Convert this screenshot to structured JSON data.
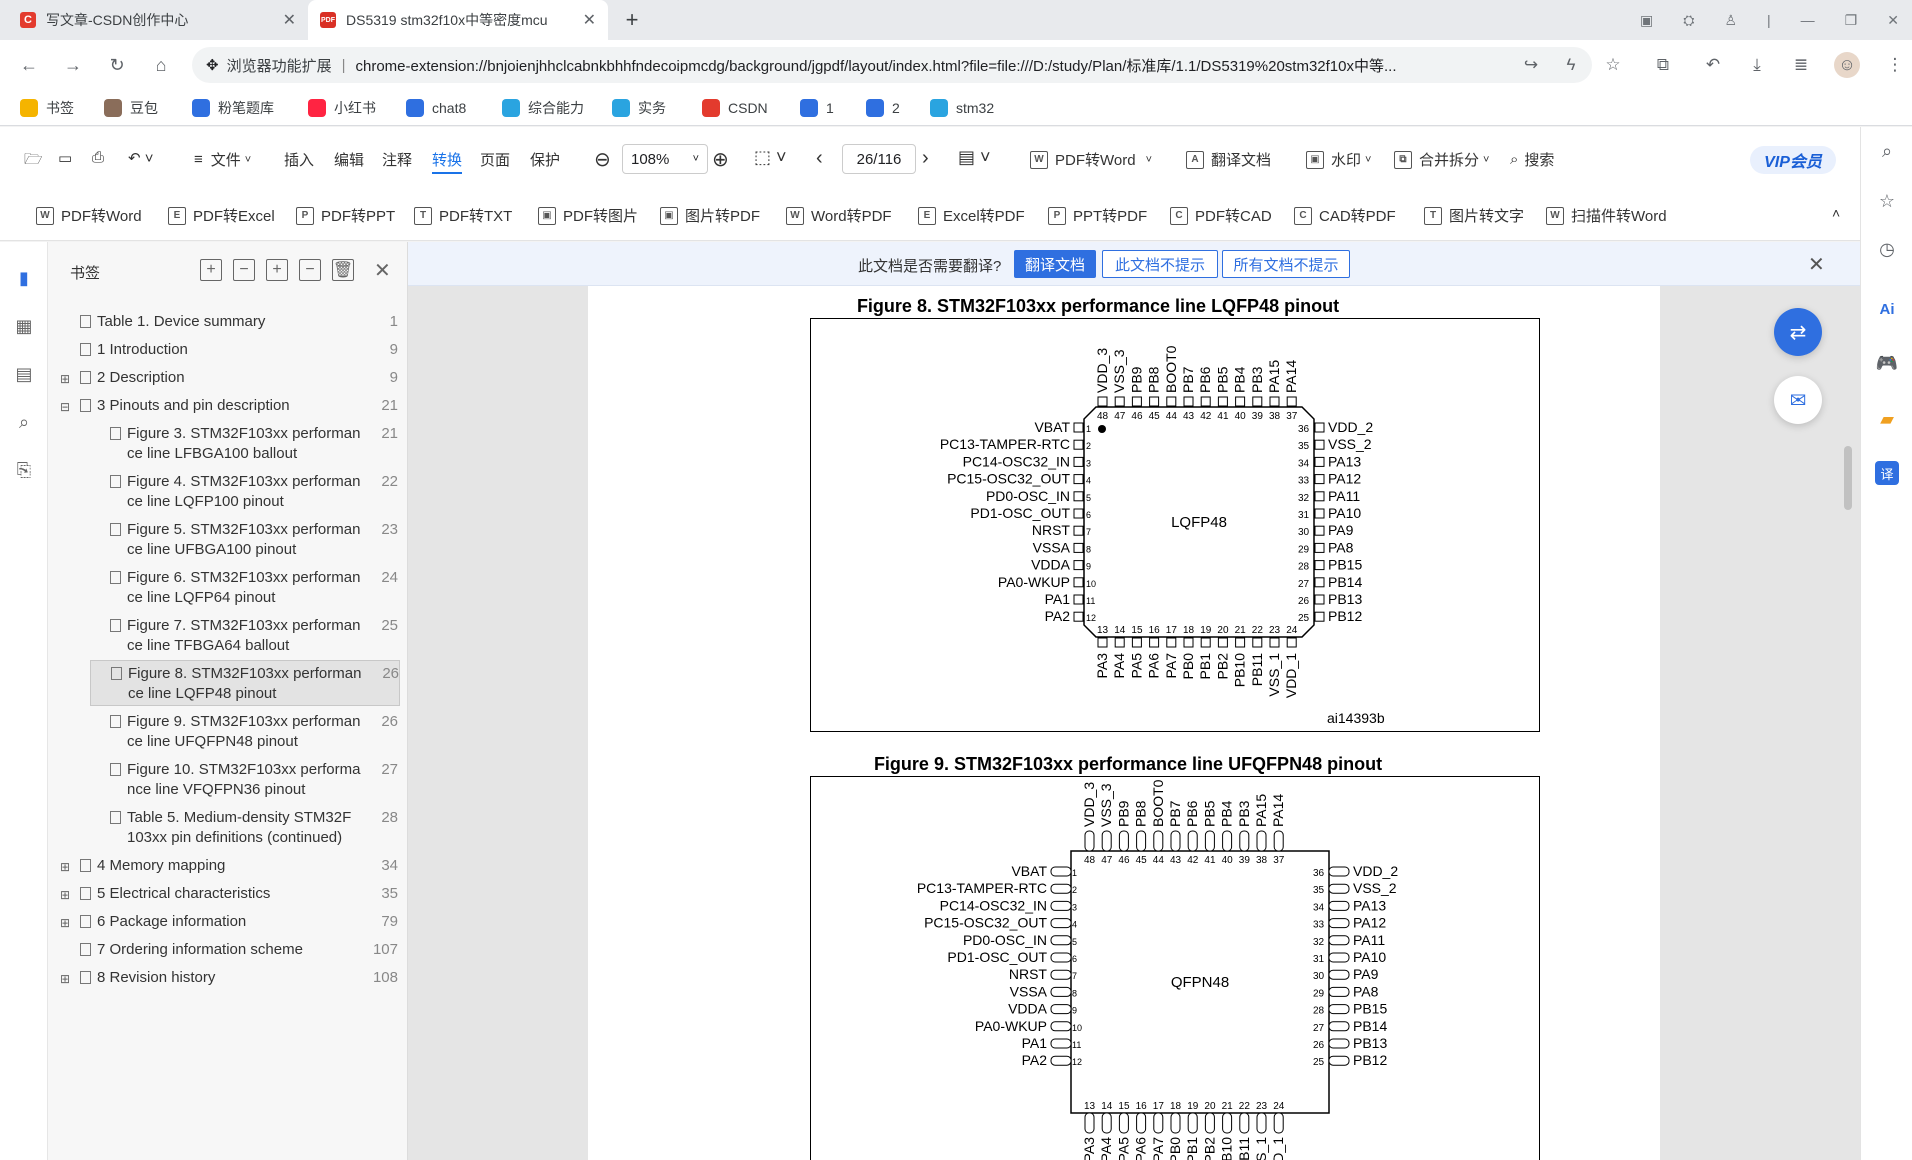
{
  "browser": {
    "tabs": [
      {
        "title": "写文章-CSDN创作中心",
        "favicon": "C"
      },
      {
        "title": "DS5319 stm32f10x中等密度mcu",
        "favicon": "PDF"
      }
    ],
    "address": {
      "ext_label": "浏览器功能扩展",
      "url": "chrome-extension://bnjoienjhhclcabnkbhhfndecoipmcdg/background/jgpdf/layout/index.html?file=file:///D:/study/Plan/标准库/1.1/DS5319%20stm32f10x中等..."
    },
    "bookmarks": [
      {
        "label": "书签",
        "icon": "star-icon",
        "color": "#f5b400"
      },
      {
        "label": "豆包",
        "icon": "avatar-icon",
        "color": "#8a6d5a"
      },
      {
        "label": "粉笔题库",
        "icon": "fb-icon",
        "color": "#2f6fe0"
      },
      {
        "label": "小红书",
        "icon": "xhs-icon",
        "color": "#ff2442"
      },
      {
        "label": "chat8",
        "icon": "chat-icon",
        "color": "#2f6fe0"
      },
      {
        "label": "综合能力",
        "icon": "bili-icon",
        "color": "#2aa4e0"
      },
      {
        "label": "实务",
        "icon": "bili-icon",
        "color": "#2aa4e0"
      },
      {
        "label": "CSDN",
        "icon": "csdn-icon",
        "color": "#e33b2e"
      },
      {
        "label": "1",
        "icon": "cloud-icon",
        "color": "#2f6fe0"
      },
      {
        "label": "2",
        "icon": "cloud-icon",
        "color": "#2f6fe0"
      },
      {
        "label": "stm32",
        "icon": "bili-icon",
        "color": "#2aa4e0"
      }
    ]
  },
  "toolbar": {
    "menu": [
      "文件",
      "插入",
      "编辑",
      "注释",
      "转换",
      "页面",
      "保护"
    ],
    "selected_menu": "转换",
    "zoom": "108%",
    "page": "26/116",
    "pdf_to_word": "PDF转Word",
    "translate_doc": "翻译文档",
    "watermark": "水印",
    "merge_split": "合并拆分",
    "search": "搜索",
    "vip": "VIP会员",
    "convert_items": [
      "PDF转Word",
      "PDF转Excel",
      "PDF转PPT",
      "PDF转TXT",
      "PDF转图片",
      "图片转PDF",
      "Word转PDF",
      "Excel转PDF",
      "PPT转PDF",
      "PDF转CAD",
      "CAD转PDF",
      "图片转文字",
      "扫描件转Word"
    ]
  },
  "bookmark_panel": {
    "title": "书签",
    "items": [
      {
        "text": "Table 1. Device summary",
        "page": "1",
        "indent": 0,
        "expand": ""
      },
      {
        "text": "1 Introduction",
        "page": "9",
        "indent": 0,
        "expand": ""
      },
      {
        "text": "2 Description",
        "page": "9",
        "indent": 0,
        "expand": "+"
      },
      {
        "text": "3 Pinouts and pin description",
        "page": "21",
        "indent": 0,
        "expand": "−"
      },
      {
        "text": "Figure 3. STM32F103xx performan ce line LFBGA100 ballout",
        "page": "21",
        "indent": 1,
        "expand": ""
      },
      {
        "text": "Figure 4. STM32F103xx performan ce line LQFP100 pinout",
        "page": "22",
        "indent": 1,
        "expand": ""
      },
      {
        "text": "Figure 5. STM32F103xx performan ce line UFBGA100 pinout",
        "page": "23",
        "indent": 1,
        "expand": ""
      },
      {
        "text": "Figure 6. STM32F103xx performan ce line LQFP64 pinout",
        "page": "24",
        "indent": 1,
        "expand": ""
      },
      {
        "text": "Figure 7. STM32F103xx performan ce line TFBGA64 ballout",
        "page": "25",
        "indent": 1,
        "expand": ""
      },
      {
        "text": "Figure 8. STM32F103xx performan ce line LQFP48 pinout",
        "page": "26",
        "indent": 1,
        "expand": "",
        "selected": true
      },
      {
        "text": "Figure 9. STM32F103xx performan ce line UFQFPN48 pinout",
        "page": "26",
        "indent": 1,
        "expand": ""
      },
      {
        "text": "Figure 10. STM32F103xx performa nce line VFQFPN36 pinout",
        "page": "27",
        "indent": 1,
        "expand": ""
      },
      {
        "text": "Table 5. Medium-density STM32F 103xx pin definitions (continued)",
        "page": "28",
        "indent": 1,
        "expand": ""
      },
      {
        "text": "4 Memory mapping",
        "page": "34",
        "indent": 0,
        "expand": "+"
      },
      {
        "text": "5 Electrical characteristics",
        "page": "35",
        "indent": 0,
        "expand": "+"
      },
      {
        "text": "6 Package information",
        "page": "79",
        "indent": 0,
        "expand": "+"
      },
      {
        "text": "7 Ordering information scheme",
        "page": "107",
        "indent": 0,
        "expand": ""
      },
      {
        "text": "8 Revision history",
        "page": "108",
        "indent": 0,
        "expand": "+"
      }
    ]
  },
  "translate_bar": {
    "question": "此文档是否需要翻译?",
    "btn_translate": "翻译文档",
    "btn_no_this": "此文档不提示",
    "btn_no_all": "所有文档不提示"
  },
  "document": {
    "fig8": {
      "caption": "Figure 8. STM32F103xx performance line LQFP48 pinout",
      "chip": "LQFP48",
      "ref": "ai14393b"
    },
    "fig9": {
      "caption": "Figure 9. STM32F103xx performance line UFQFPN48 pinout",
      "chip": "QFPN48"
    },
    "pins_left": [
      "VBAT",
      "PC13-TAMPER-RTC",
      "PC14-OSC32_IN",
      "PC15-OSC32_OUT",
      "PD0-OSC_IN",
      "PD1-OSC_OUT",
      "NRST",
      "VSSA",
      "VDDA",
      "PA0-WKUP",
      "PA1",
      "PA2"
    ],
    "pins_bottom": [
      "PA3",
      "PA4",
      "PA5",
      "PA6",
      "PA7",
      "PB0",
      "PB1",
      "PB2",
      "PB10",
      "PB11",
      "VSS_1",
      "VDD_1"
    ],
    "pins_right": [
      "PB12",
      "PB13",
      "PB14",
      "PB15",
      "PA8",
      "PA9",
      "PA10",
      "PA11",
      "PA12",
      "PA13",
      "VSS_2",
      "VDD_2"
    ],
    "pins_top": [
      "PA14",
      "PA15",
      "PB3",
      "PB4",
      "PB5",
      "PB6",
      "PB7",
      "BOOT0",
      "PB8",
      "PB9",
      "VSS_3",
      "VDD_3"
    ]
  }
}
